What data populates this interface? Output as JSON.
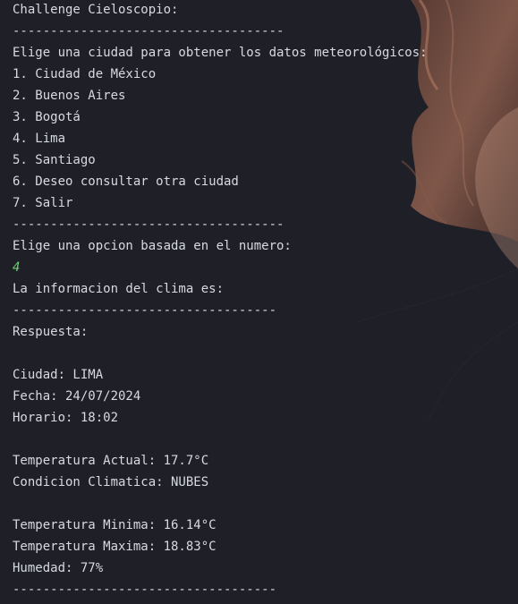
{
  "console": {
    "title": "Challenge Cieloscopio:",
    "separator_long": "------------------------------------",
    "separator_short": "-----------------------------------",
    "prompt_city": "Elige una ciudad para obtener los datos meteorológicos:",
    "menu": [
      "1. Ciudad de México",
      "2. Buenos Aires",
      "3. Bogotá",
      "4. Lima",
      "5. Santiago",
      "6. Deseo consultar otra ciudad",
      "7. Salir"
    ],
    "prompt_option": "Elige una opcion basada en el numero:",
    "user_input": "4",
    "info_header": "La informacion del clima es:",
    "response_label": "Respuesta:",
    "city": "Ciudad: LIMA",
    "date": "Fecha: 24/07/2024",
    "time": "Horario: 18:02",
    "temp_current": "Temperatura Actual: 17.7°C",
    "condition": "Condicion Climatica: NUBES",
    "temp_min": "Temperatura Minima: 16.14°C",
    "temp_max": "Temperatura Maxima: 18.83°C",
    "humidity": "Humedad: 77%"
  },
  "colors": {
    "background": "#1e1f27",
    "text": "#d7dae0",
    "input": "#6fcf73",
    "hair": "#8a5a4a"
  }
}
